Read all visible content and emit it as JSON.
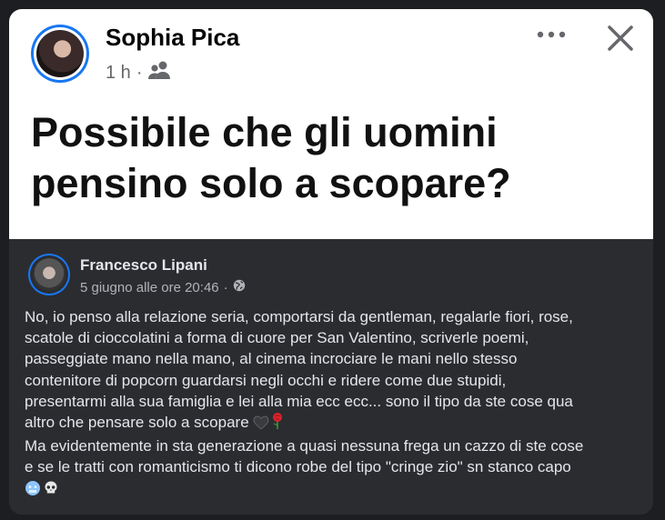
{
  "post": {
    "author": "Sophia Pica",
    "time": "1 h",
    "separator": "·",
    "audience_icon": "friends-icon",
    "headline": "Possibile che gli uomini pensino solo a scopare?"
  },
  "embedded_post": {
    "author": "Francesco Lipani",
    "timestamp": "5 giugno alle ore 20:46",
    "separator": "·",
    "audience_icon": "globe-icon",
    "lines": [
      "No, io penso alla relazione seria, comportarsi da gentleman, regalarle fiori, rose,",
      "scatole di cioccolatini a forma di cuore per San Valentino, scriverle poemi,",
      "passeggiate mano nella mano, al cinema incrociare le mani nello stesso",
      "contenitore di popcorn guardarsi negli occhi e ridere come due stupidi,",
      "presentarmi alla sua famiglia e lei alla mia ecc ecc... sono il tipo da ste cose qua",
      "altro che pensare solo a  scopare",
      "Ma evidentemente in sta generazione a quasi nessuna frega un cazzo di ste cose",
      "e se le tratti con romanticismo ti dicono robe del tipo \"cringe zio\" sn stanco capo"
    ],
    "emoji_line6": [
      "black-heart-icon",
      "rose-icon"
    ],
    "emoji_line9": [
      "cold-face-icon",
      "skull-icon"
    ]
  },
  "colors": {
    "accent": "#1877f2",
    "dark_bg": "#2b2c30",
    "light_text": "#e4e6eb",
    "muted_text": "#b0b3b8"
  }
}
